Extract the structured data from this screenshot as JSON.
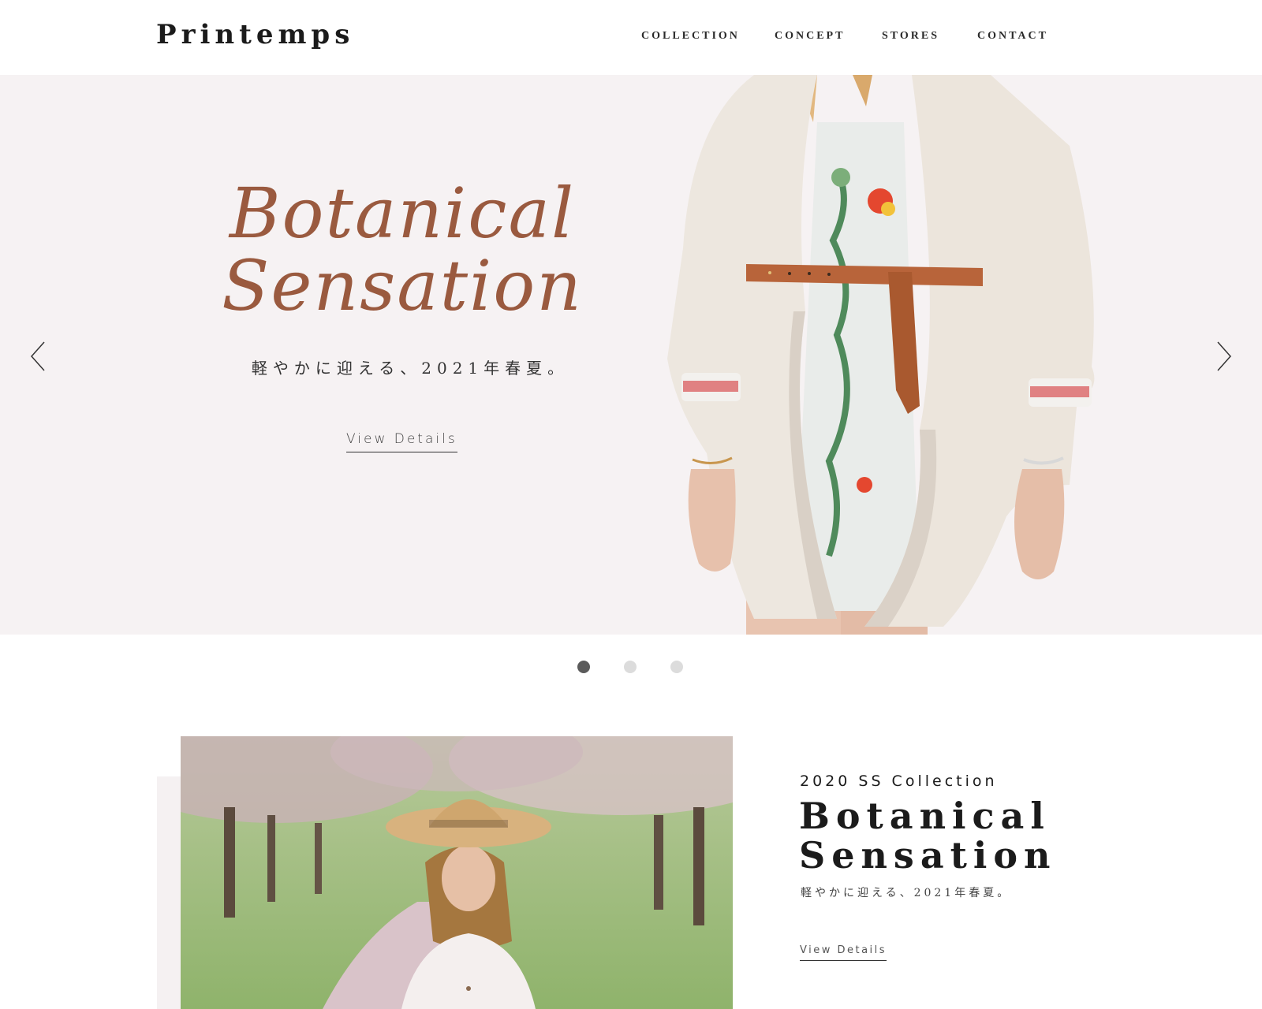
{
  "header": {
    "logo": "Printemps",
    "nav": [
      "COLLECTION",
      "CONCEPT",
      "STORES",
      "CONTACT"
    ]
  },
  "hero": {
    "script_line1": "Botanical",
    "script_line2": "Sensation",
    "subtitle": "軽やかに迎える、2021年春夏。",
    "cta": "View Details",
    "prev_icon": "chevron-left-icon",
    "next_icon": "chevron-right-icon"
  },
  "carousel": {
    "slides": 3,
    "active_index": 0
  },
  "feature": {
    "eyebrow": "2020 SS Collection",
    "title_line1": "Botanical",
    "title_line2": "Sensation",
    "subtitle": "軽やかに迎える、2021年春夏。",
    "cta": "View Details"
  },
  "colors": {
    "script_accent": "#9a5a3f",
    "hero_bg": "#f6f2f3",
    "dot_active": "#5b5b5b",
    "dot_inactive": "#dcdcdc"
  }
}
